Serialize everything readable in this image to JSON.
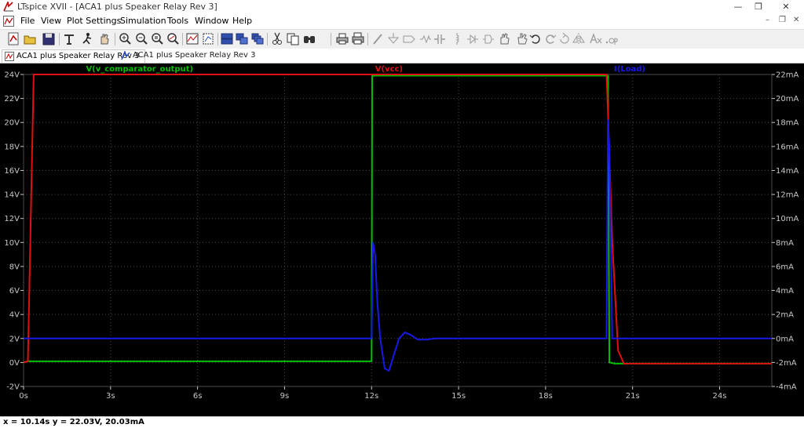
{
  "window": {
    "title": "LTspice XVII - [ACA1 plus Speaker Relay Rev 3]",
    "controls": {
      "minimize": "—",
      "maximize": "❐",
      "close": "✕"
    },
    "mdi_controls": {
      "minimize": "–",
      "restore": "❐",
      "close": "✕"
    }
  },
  "menu": {
    "items": [
      "File",
      "View",
      "Plot Settings",
      "Simulation",
      "Tools",
      "Window",
      "Help"
    ]
  },
  "toolbar": {
    "buttons": [
      "new-schematic-icon",
      "open-icon",
      "save-icon",
      "control-panel-icon",
      "run-icon",
      "halt-icon",
      "zoom-in-icon",
      "zoom-out-icon",
      "zoom-area-icon",
      "zoom-fit-icon",
      "autorange-icon",
      "zoom-extents-icon",
      "tile-vertical-icon",
      "tile-horizontal-icon",
      "cascade-icon",
      "cut-icon",
      "copy-icon",
      "find-icon",
      "print-icon",
      "print-setup-icon",
      "wire-icon",
      "ground-icon",
      "label-icon",
      "resistor-icon",
      "capacitor-icon",
      "inductor-icon",
      "diode-icon",
      "component-icon",
      "move-icon",
      "drag-icon",
      "undo-icon",
      "redo-icon",
      "rotate-icon",
      "mirror-icon",
      "text-icon",
      "spice-directive-icon"
    ]
  },
  "tabs": [
    {
      "label": "ACA1 plus Speaker Relay Rev 3",
      "active": true
    },
    {
      "label": "ACA1 plus Speaker Relay Rev 3",
      "active": false
    }
  ],
  "colors": {
    "background": "#000000",
    "grid": "#4a4a4a",
    "axis_text": "#c8c8c8",
    "v_comparator_output": "#00c000",
    "vcc": "#e01010",
    "iload": "#1818e8"
  },
  "chart_data": {
    "type": "line",
    "x_unit": "s",
    "xlim": [
      0,
      25.8
    ],
    "x_ticks": [
      0,
      3,
      6,
      9,
      12,
      15,
      18,
      21,
      24
    ],
    "x_tick_labels": [
      "0s",
      "3s",
      "6s",
      "9s",
      "12s",
      "15s",
      "18s",
      "21s",
      "24s"
    ],
    "y_left": {
      "unit": "V",
      "lim": [
        -2,
        24
      ],
      "ticks": [
        -2,
        0,
        2,
        4,
        6,
        8,
        10,
        12,
        14,
        16,
        18,
        20,
        22,
        24
      ],
      "tick_labels": [
        "-2V",
        "0V",
        "2V",
        "4V",
        "6V",
        "8V",
        "10V",
        "12V",
        "14V",
        "16V",
        "18V",
        "20V",
        "22V",
        "24V"
      ]
    },
    "y_right": {
      "unit": "mA",
      "lim": [
        -4,
        22
      ],
      "ticks": [
        -4,
        -2,
        0,
        2,
        4,
        6,
        8,
        10,
        12,
        14,
        16,
        18,
        20,
        22
      ],
      "tick_labels": [
        "-4mA",
        "-2mA",
        "0mA",
        "2mA",
        "4mA",
        "6mA",
        "8mA",
        "10mA",
        "12mA",
        "14mA",
        "16mA",
        "18mA",
        "20mA",
        "22mA"
      ]
    },
    "grid": true,
    "series": [
      {
        "name": "V(v_comparator_output)",
        "axis": "left",
        "color": "#00c000",
        "points": [
          [
            0,
            0
          ],
          [
            0.15,
            0.1
          ],
          [
            12,
            0.1
          ],
          [
            12.02,
            23.9
          ],
          [
            20.15,
            23.9
          ],
          [
            20.2,
            0
          ],
          [
            20.4,
            -0.1
          ],
          [
            25.8,
            -0.1
          ]
        ]
      },
      {
        "name": "V(vcc)",
        "axis": "left",
        "color": "#e01010",
        "points": [
          [
            0,
            0
          ],
          [
            0.15,
            0.1
          ],
          [
            0.35,
            24
          ],
          [
            20.1,
            24
          ],
          [
            20.15,
            20.8
          ],
          [
            20.3,
            10
          ],
          [
            20.5,
            1
          ],
          [
            20.7,
            -0.1
          ],
          [
            25.8,
            -0.1
          ]
        ]
      },
      {
        "name": "I(Load)",
        "axis": "right",
        "color": "#1818e8",
        "points": [
          [
            0,
            0
          ],
          [
            12,
            0
          ],
          [
            12.05,
            8
          ],
          [
            12.12,
            7
          ],
          [
            12.2,
            3
          ],
          [
            12.3,
            0
          ],
          [
            12.45,
            -2.5
          ],
          [
            12.6,
            -2.7
          ],
          [
            12.75,
            -1.5
          ],
          [
            12.95,
            0
          ],
          [
            13.15,
            0.5
          ],
          [
            13.35,
            0.3
          ],
          [
            13.6,
            -0.1
          ],
          [
            13.9,
            -0.1
          ],
          [
            14.2,
            0
          ],
          [
            20.1,
            0
          ],
          [
            20.15,
            18.2
          ],
          [
            20.2,
            16
          ],
          [
            20.25,
            8
          ],
          [
            20.3,
            0
          ],
          [
            25.8,
            0
          ]
        ]
      }
    ]
  },
  "status": {
    "text": "x = 10.14s    y = 22.03V, 20.03mA"
  }
}
